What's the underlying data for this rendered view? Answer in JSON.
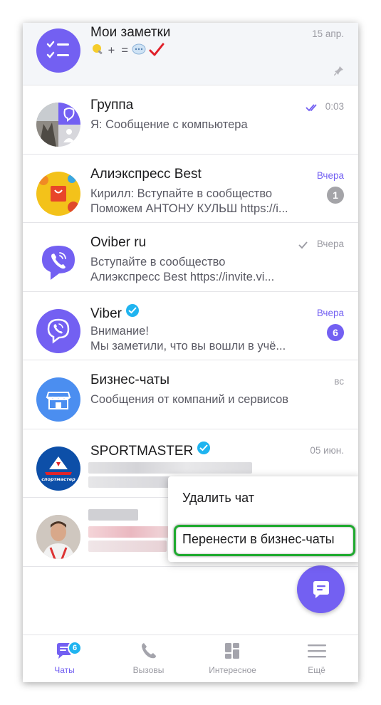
{
  "chats": [
    {
      "name": "Мои заметки",
      "preview_line1": "+  =",
      "time": "15 апр.",
      "pinned": true
    },
    {
      "name": "Группа",
      "preview_line1": "Я: Сообщение с компьютера",
      "time": "0:03"
    },
    {
      "name": "Алиэкспресс Best",
      "preview_line1": "Кирилл: Вступайте в сообщество",
      "preview_line2": "Поможем АНТОНУ КУЛЬШ https://i...",
      "time": "Вчера",
      "badge": "1"
    },
    {
      "name": "Oviber ru",
      "preview_line1": "Вступайте в сообщество",
      "preview_line2": "Алиэкспресс Best https://invite.vi...",
      "time": "Вчера"
    },
    {
      "name": "Viber",
      "preview_line1": "Внимание!",
      "preview_line2": "Мы заметили, что вы вошли в учё...",
      "time": "Вчера",
      "badge": "6"
    },
    {
      "name": "Бизнес-чаты",
      "preview_line1": "Сообщения от компаний и сервисов",
      "time": "вс"
    },
    {
      "name": "SPORTMASTER",
      "time": "05 июн."
    },
    {
      "name": ""
    }
  ],
  "avatar_text": {
    "sportmaster": "спортмастер"
  },
  "context_menu": {
    "delete_label": "Удалить чат",
    "move_label": "Перенести в бизнес-чаты"
  },
  "bottom_nav": {
    "chats_label": "Чаты",
    "chats_badge": "6",
    "calls_label": "Вызовы",
    "explore_label": "Интересное",
    "more_label": "Ещё"
  },
  "colors": {
    "accent": "#7360f2",
    "verified": "#1fb4f0",
    "highlight": "#1faa2f"
  },
  "icons": [
    "notes-icon",
    "pin-icon",
    "double-check-icon",
    "check-icon",
    "verified-icon",
    "storefront-icon",
    "compose-icon",
    "chats-icon",
    "calls-icon",
    "explore-icon",
    "more-icon"
  ]
}
